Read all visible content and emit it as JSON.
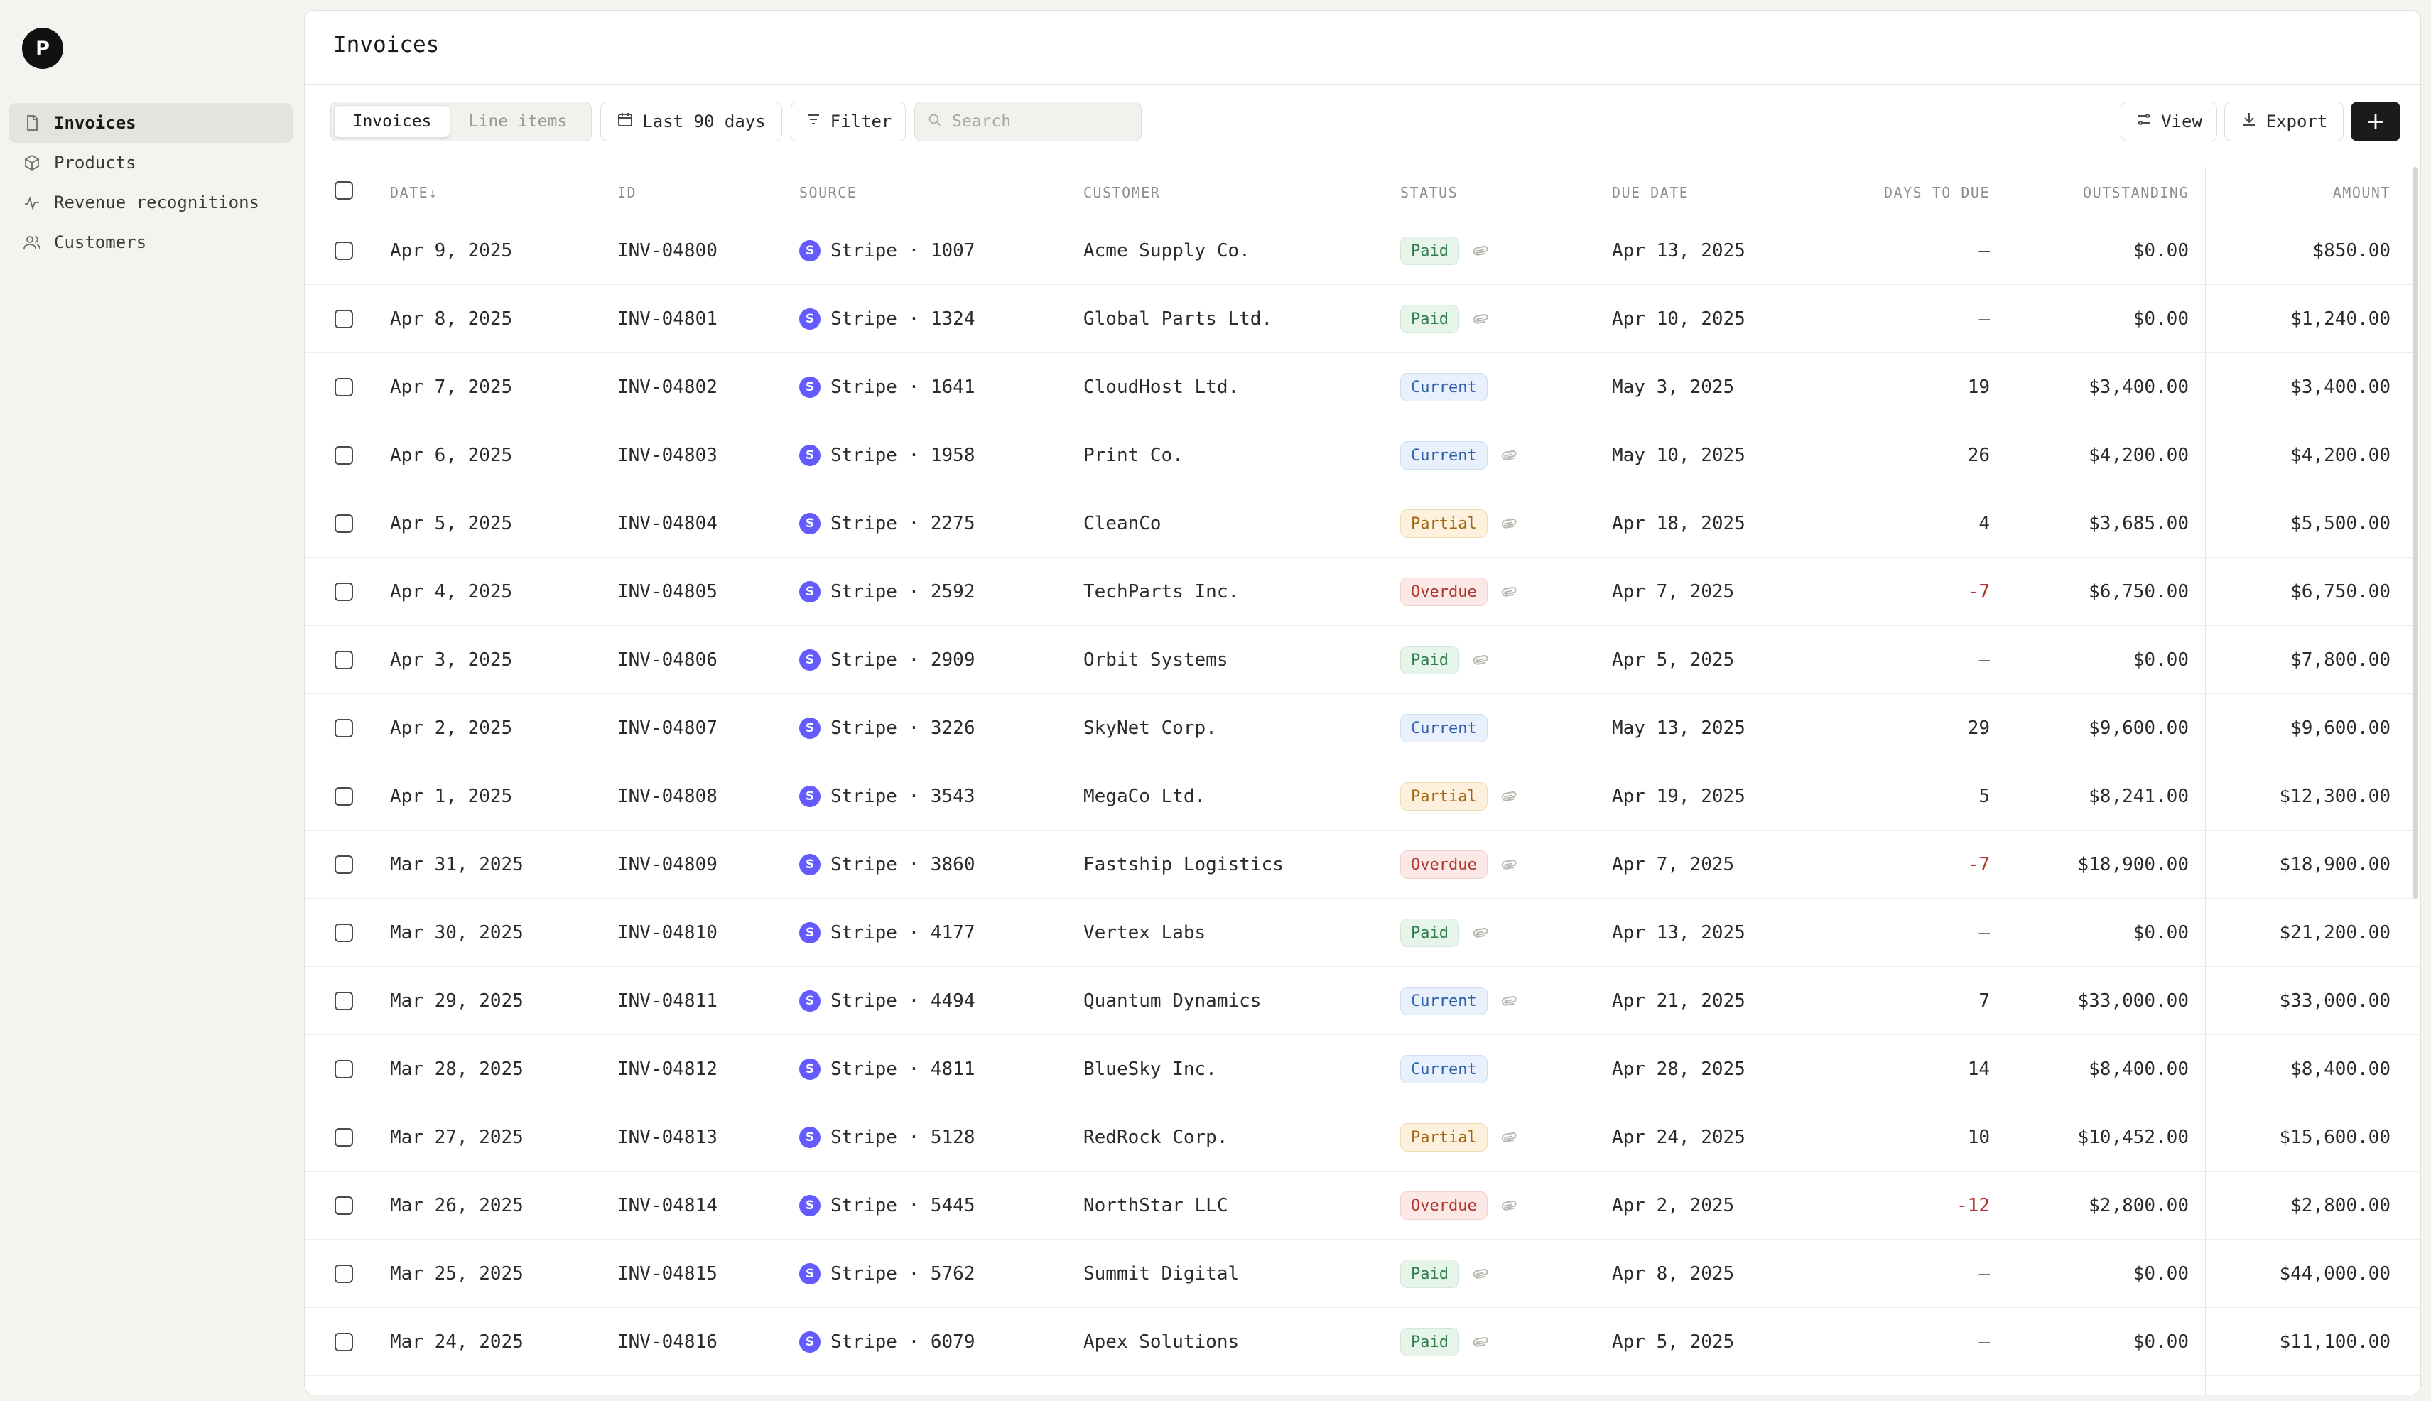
{
  "sidebar": {
    "logo_letter": "P",
    "items": [
      {
        "label": "Invoices",
        "icon": "file-icon",
        "active": true
      },
      {
        "label": "Products",
        "icon": "box-icon",
        "active": false
      },
      {
        "label": "Revenue recognitions",
        "icon": "activity-icon",
        "active": false
      },
      {
        "label": "Customers",
        "icon": "users-icon",
        "active": false
      }
    ]
  },
  "header": {
    "title": "Invoices"
  },
  "toolbar": {
    "tabs": [
      "Invoices",
      "Line items"
    ],
    "date_range_label": "Last 90 days",
    "filter_label": "Filter",
    "search_placeholder": "Search",
    "view_label": "View",
    "export_label": "Export",
    "add_label": "+"
  },
  "table": {
    "columns": {
      "date": "Date↓",
      "id": "ID",
      "source": "Source",
      "customer": "Customer",
      "status": "Status",
      "due_date": "Due date",
      "days_to_due": "Days to due",
      "outstanding": "Outstanding",
      "amount": "Amount"
    },
    "rows": [
      {
        "date": "Apr 9, 2025",
        "id": "INV-04800",
        "source": "Stripe · 1007",
        "customer": "Acme Supply Co.",
        "status": "Paid",
        "attach": true,
        "due": "Apr 13, 2025",
        "days": "—",
        "outstanding": "$0.00",
        "amount": "$850.00"
      },
      {
        "date": "Apr 8, 2025",
        "id": "INV-04801",
        "source": "Stripe · 1324",
        "customer": "Global Parts Ltd.",
        "status": "Paid",
        "attach": true,
        "due": "Apr 10, 2025",
        "days": "—",
        "outstanding": "$0.00",
        "amount": "$1,240.00"
      },
      {
        "date": "Apr 7, 2025",
        "id": "INV-04802",
        "source": "Stripe · 1641",
        "customer": "CloudHost Ltd.",
        "status": "Current",
        "attach": false,
        "due": "May 3, 2025",
        "days": "19",
        "outstanding": "$3,400.00",
        "amount": "$3,400.00"
      },
      {
        "date": "Apr 6, 2025",
        "id": "INV-04803",
        "source": "Stripe · 1958",
        "customer": "Print Co.",
        "status": "Current",
        "attach": true,
        "due": "May 10, 2025",
        "days": "26",
        "outstanding": "$4,200.00",
        "amount": "$4,200.00"
      },
      {
        "date": "Apr 5, 2025",
        "id": "INV-04804",
        "source": "Stripe · 2275",
        "customer": "CleanCo",
        "status": "Partial",
        "attach": true,
        "due": "Apr 18, 2025",
        "days": "4",
        "outstanding": "$3,685.00",
        "amount": "$5,500.00"
      },
      {
        "date": "Apr 4, 2025",
        "id": "INV-04805",
        "source": "Stripe · 2592",
        "customer": "TechParts Inc.",
        "status": "Overdue",
        "attach": true,
        "due": "Apr 7, 2025",
        "days": "-7",
        "outstanding": "$6,750.00",
        "amount": "$6,750.00"
      },
      {
        "date": "Apr 3, 2025",
        "id": "INV-04806",
        "source": "Stripe · 2909",
        "customer": "Orbit Systems",
        "status": "Paid",
        "attach": true,
        "due": "Apr 5, 2025",
        "days": "—",
        "outstanding": "$0.00",
        "amount": "$7,800.00"
      },
      {
        "date": "Apr 2, 2025",
        "id": "INV-04807",
        "source": "Stripe · 3226",
        "customer": "SkyNet Corp.",
        "status": "Current",
        "attach": false,
        "due": "May 13, 2025",
        "days": "29",
        "outstanding": "$9,600.00",
        "amount": "$9,600.00"
      },
      {
        "date": "Apr 1, 2025",
        "id": "INV-04808",
        "source": "Stripe · 3543",
        "customer": "MegaCo Ltd.",
        "status": "Partial",
        "attach": true,
        "due": "Apr 19, 2025",
        "days": "5",
        "outstanding": "$8,241.00",
        "amount": "$12,300.00"
      },
      {
        "date": "Mar 31, 2025",
        "id": "INV-04809",
        "source": "Stripe · 3860",
        "customer": "Fastship Logistics",
        "status": "Overdue",
        "attach": true,
        "due": "Apr 7, 2025",
        "days": "-7",
        "outstanding": "$18,900.00",
        "amount": "$18,900.00"
      },
      {
        "date": "Mar 30, 2025",
        "id": "INV-04810",
        "source": "Stripe · 4177",
        "customer": "Vertex Labs",
        "status": "Paid",
        "attach": true,
        "due": "Apr 13, 2025",
        "days": "—",
        "outstanding": "$0.00",
        "amount": "$21,200.00"
      },
      {
        "date": "Mar 29, 2025",
        "id": "INV-04811",
        "source": "Stripe · 4494",
        "customer": "Quantum Dynamics",
        "status": "Current",
        "attach": true,
        "due": "Apr 21, 2025",
        "days": "7",
        "outstanding": "$33,000.00",
        "amount": "$33,000.00"
      },
      {
        "date": "Mar 28, 2025",
        "id": "INV-04812",
        "source": "Stripe · 4811",
        "customer": "BlueSky Inc.",
        "status": "Current",
        "attach": false,
        "due": "Apr 28, 2025",
        "days": "14",
        "outstanding": "$8,400.00",
        "amount": "$8,400.00"
      },
      {
        "date": "Mar 27, 2025",
        "id": "INV-04813",
        "source": "Stripe · 5128",
        "customer": "RedRock Corp.",
        "status": "Partial",
        "attach": true,
        "due": "Apr 24, 2025",
        "days": "10",
        "outstanding": "$10,452.00",
        "amount": "$15,600.00"
      },
      {
        "date": "Mar 26, 2025",
        "id": "INV-04814",
        "source": "Stripe · 5445",
        "customer": "NorthStar LLC",
        "status": "Overdue",
        "attach": true,
        "due": "Apr 2, 2025",
        "days": "-12",
        "outstanding": "$2,800.00",
        "amount": "$2,800.00"
      },
      {
        "date": "Mar 25, 2025",
        "id": "INV-04815",
        "source": "Stripe · 5762",
        "customer": "Summit Digital",
        "status": "Paid",
        "attach": true,
        "due": "Apr 8, 2025",
        "days": "—",
        "outstanding": "$0.00",
        "amount": "$44,000.00"
      },
      {
        "date": "Mar 24, 2025",
        "id": "INV-04816",
        "source": "Stripe · 6079",
        "customer": "Apex Solutions",
        "status": "Paid",
        "attach": true,
        "due": "Apr 5, 2025",
        "days": "—",
        "outstanding": "$0.00",
        "amount": "$11,100.00"
      }
    ]
  }
}
